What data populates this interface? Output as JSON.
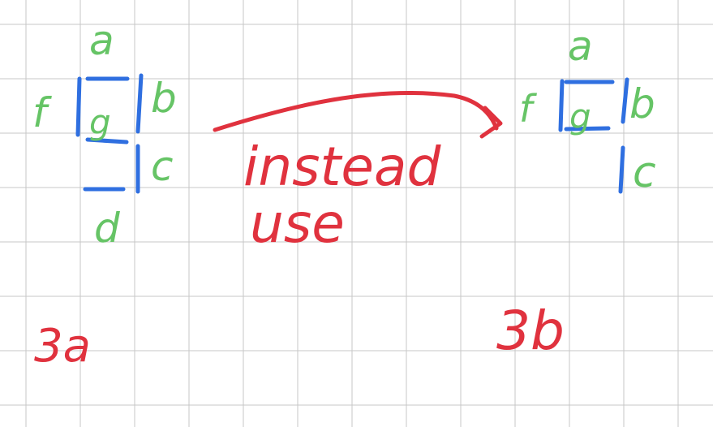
{
  "colors": {
    "grid": "#c7c7c7",
    "segment_on": "#2f6fe0",
    "segment_label": "#66c466",
    "annotation": "#e0323e"
  },
  "left_digit": {
    "labels": {
      "a": "a",
      "b": "b",
      "c": "c",
      "d": "d",
      "f": "f",
      "g": "g"
    },
    "caption": "3a"
  },
  "right_digit": {
    "labels": {
      "a": "a",
      "b": "b",
      "c": "c",
      "f": "f",
      "g": "g"
    },
    "caption": "3b"
  },
  "annotation": {
    "line1": "instead",
    "line2": "use"
  }
}
